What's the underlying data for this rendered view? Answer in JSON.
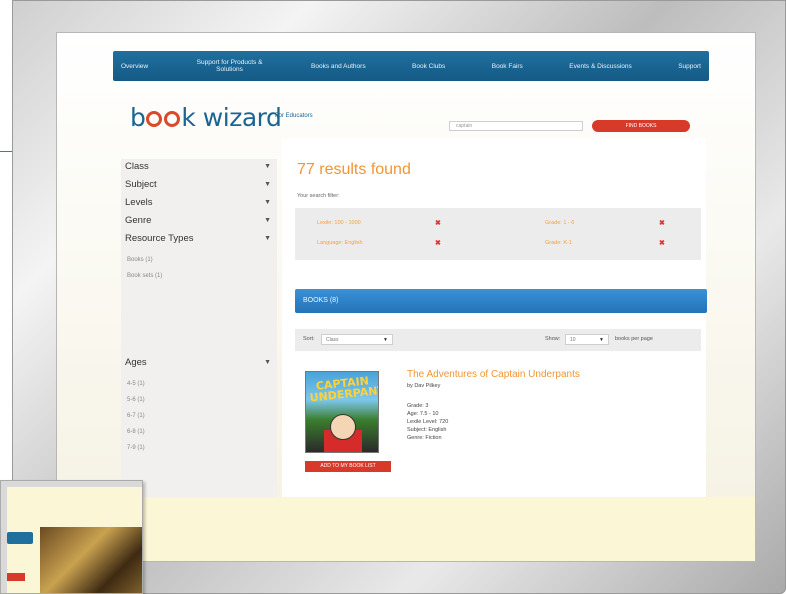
{
  "nav": {
    "items": [
      {
        "label": "Overview"
      },
      {
        "label": "Support for Products & Solutions"
      },
      {
        "label": "Books and Authors"
      },
      {
        "label": "Book Clubs"
      },
      {
        "label": "Book Fairs"
      },
      {
        "label": "Events & Discussions"
      },
      {
        "label": "Support"
      }
    ]
  },
  "brand": {
    "logo_pre": "b",
    "logo_post": "k wizard",
    "tagline": "For Educators"
  },
  "search": {
    "value": "captain",
    "button_label": "FIND BOOKS"
  },
  "sidebar": {
    "facets": [
      {
        "label": "Class"
      },
      {
        "label": "Subject"
      },
      {
        "label": "Levels"
      },
      {
        "label": "Genre"
      },
      {
        "label": "Resource Types"
      }
    ],
    "resource_options": [
      {
        "label": "Books (1)"
      },
      {
        "label": "Book sets (1)"
      }
    ],
    "ages_label": "Ages",
    "age_options": [
      {
        "label": "4-5 (1)"
      },
      {
        "label": "5-6 (1)"
      },
      {
        "label": "6-7 (1)"
      },
      {
        "label": "6-8 (1)"
      },
      {
        "label": "7-9 (1)"
      }
    ]
  },
  "results": {
    "heading": "77 results found",
    "your_search": "Your search filter:",
    "filters": [
      {
        "label": "Lexile: 100 - 1000"
      },
      {
        "label": "Grade: 1 - 6"
      },
      {
        "label": "Language: English"
      },
      {
        "label": "Grade: K-1"
      }
    ],
    "books_bar": "BOOKS (8)",
    "sort_label": "Sort:",
    "sort_value": "Class",
    "show_label": "Show:",
    "show_value": "10",
    "per_page": "books per page"
  },
  "book": {
    "title": "The Adventures of Captain Underpants",
    "author": "by Dav Pilkey",
    "cover_title": "CAPTAIN UNDERPANTS",
    "meta": [
      "Grade: 3",
      "Age: 7.5 - 10",
      "Lexile Level: 720",
      "Subject: English",
      "Genre: Fiction"
    ],
    "button": "ADD TO MY BOOK LIST"
  },
  "colors": {
    "nav": "#1f6f9f",
    "accent_orange": "#f39533",
    "accent_red": "#d83a2a",
    "books_bar": "#2a7cc2",
    "cream": "#fbf7d6"
  }
}
